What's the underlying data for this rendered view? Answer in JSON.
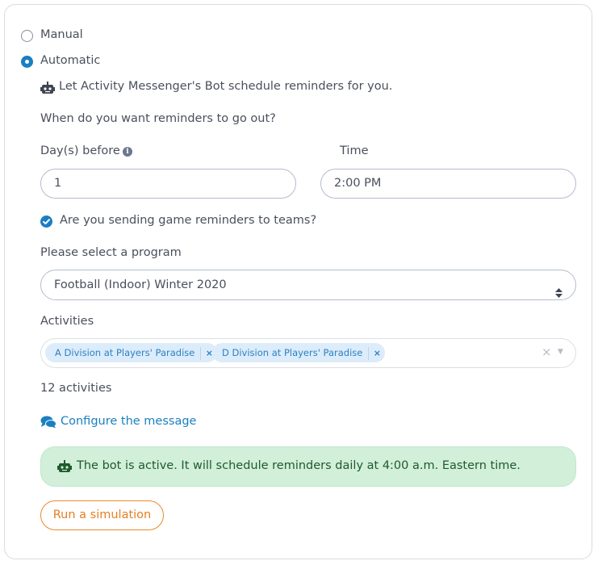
{
  "mode": {
    "options": [
      {
        "label": "Manual",
        "selected": false
      },
      {
        "label": "Automatic",
        "selected": true
      }
    ]
  },
  "bot_intro": {
    "icon": "robot-icon",
    "text": "Let Activity Messenger's Bot schedule reminders for you."
  },
  "schedule": {
    "question": "When do you want reminders to go out?",
    "days_before": {
      "label": "Day(s) before",
      "info_icon": "info-circle-icon",
      "value": "1"
    },
    "time": {
      "label": "Time",
      "value": "2:00 PM"
    }
  },
  "game_reminders": {
    "checked": true,
    "label": "Are you sending game reminders to teams?"
  },
  "program": {
    "label": "Please select a program",
    "selected": "Football (Indoor) Winter 2020",
    "icon": "sort-icon"
  },
  "activities": {
    "label": "Activities",
    "chips": [
      {
        "label": "A Division at Players' Paradise",
        "remove_icon": "×"
      },
      {
        "label": "D Division at Players' Paradise",
        "remove_icon": "×"
      }
    ],
    "clear_icon": "×",
    "dropdown_icon": "▼",
    "count_text": "12 activities"
  },
  "configure_link": {
    "icon": "comments-icon",
    "label": "Configure the message"
  },
  "status_alert": {
    "icon": "robot-icon",
    "text": "The bot is active. It will schedule reminders daily at 4:00 a.m. Eastern time."
  },
  "simulation_button": {
    "label": "Run a simulation"
  },
  "colors": {
    "primary": "#1a7fc1",
    "success_bg": "#d2efd9",
    "success_text": "#1e5a2c",
    "accent_orange": "#e67e22"
  }
}
